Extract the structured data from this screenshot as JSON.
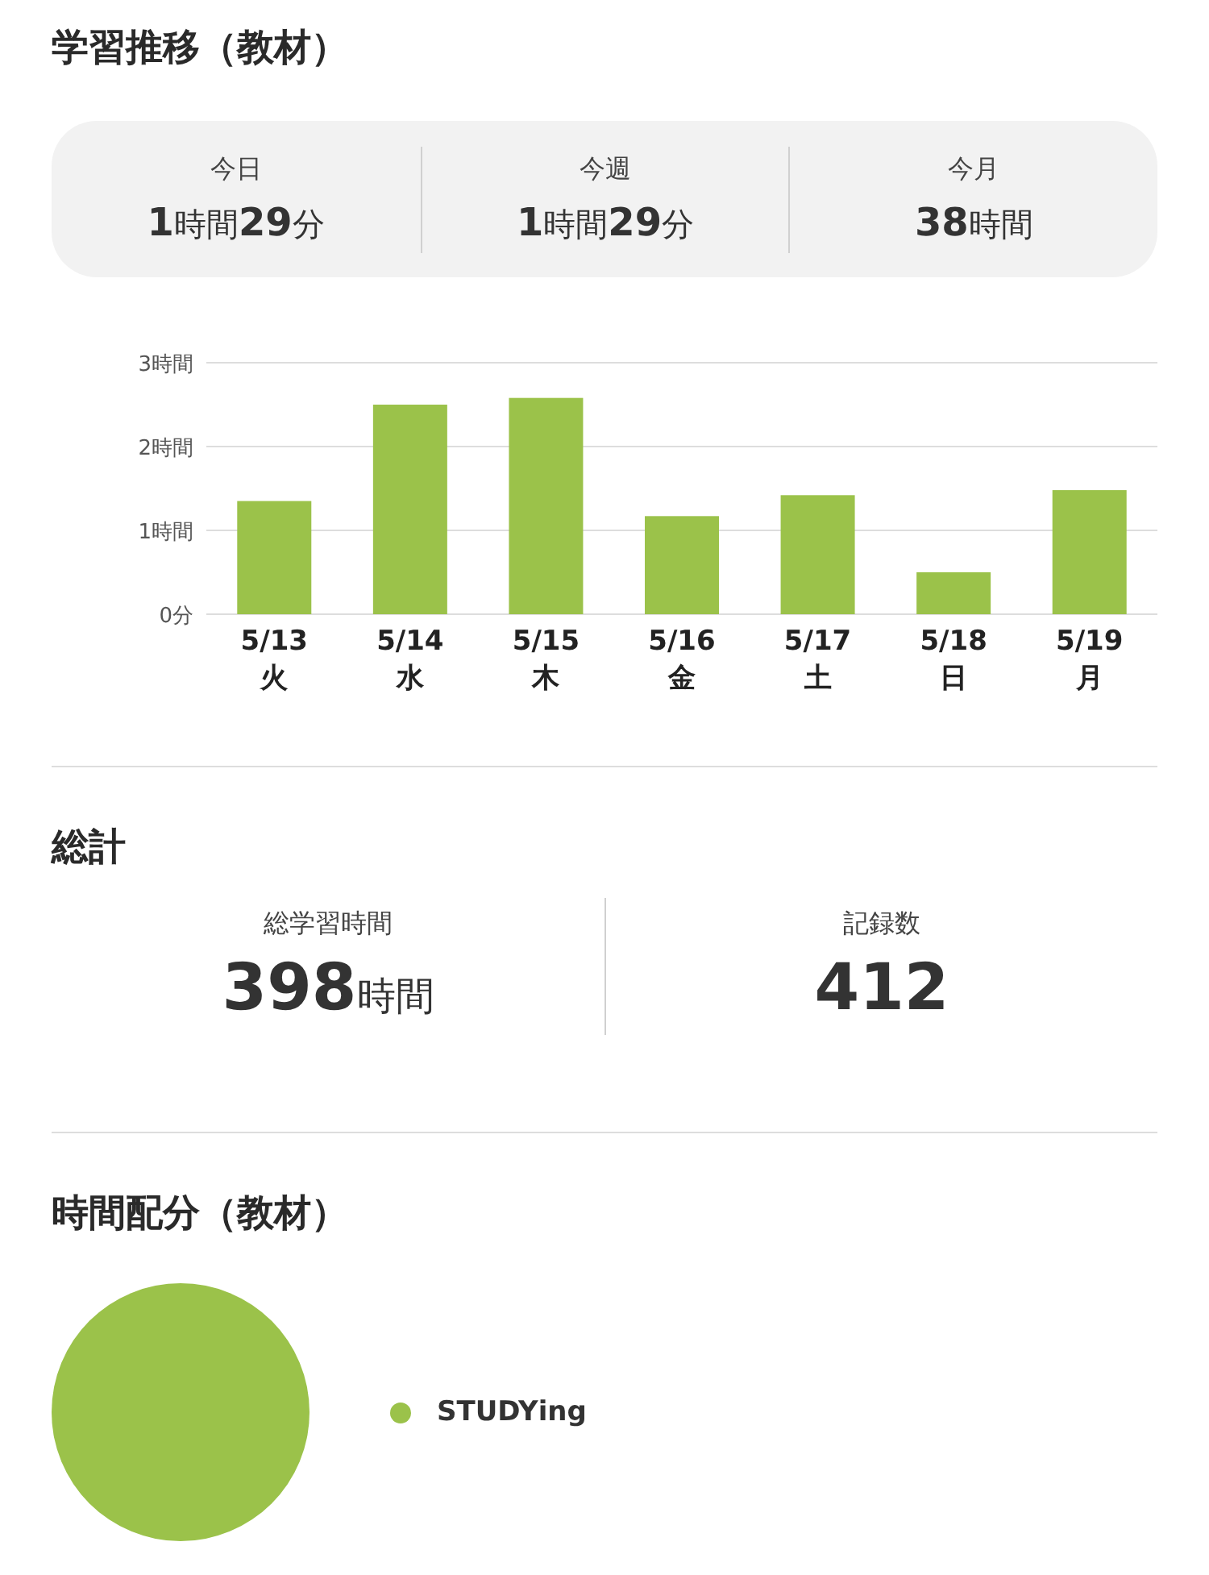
{
  "trend": {
    "title": "学習推移（教材）",
    "summary": [
      {
        "label": "今日",
        "value": "**1**時間**29**分"
      },
      {
        "label": "今週",
        "value": "**1**時間**29**分"
      },
      {
        "label": "今月",
        "value": "**38**時間"
      }
    ],
    "chart_data": {
      "type": "bar",
      "categories": [
        "5/13\n火",
        "5/14\n水",
        "5/15\n木",
        "5/16\n金",
        "5/17\n土",
        "5/18\n日",
        "5/19\n月"
      ],
      "series": [
        {
          "color": "#9bc24a",
          "values": [
            1.35,
            2.5,
            2.58,
            1.17,
            1.42,
            0.5,
            1.48
          ]
        }
      ],
      "ylim": [
        0,
        3
      ],
      "yticks": [
        {
          "value": 0,
          "label": "0分"
        },
        {
          "value": 1,
          "label": "1時間"
        },
        {
          "value": 2,
          "label": "2時間"
        },
        {
          "value": 3,
          "label": "3時間"
        }
      ]
    }
  },
  "totals": {
    "title": "総計",
    "stats": [
      {
        "label": "総学習時間",
        "value": "**398**時間"
      },
      {
        "label": "記録数",
        "value": "**412**"
      }
    ]
  },
  "allocation": {
    "title": "時間配分（教材）",
    "chart_data": {
      "type": "pie",
      "series": [
        {
          "name": "STUDYing",
          "color": "#9bc24a",
          "values": [
            100
          ]
        }
      ]
    }
  }
}
